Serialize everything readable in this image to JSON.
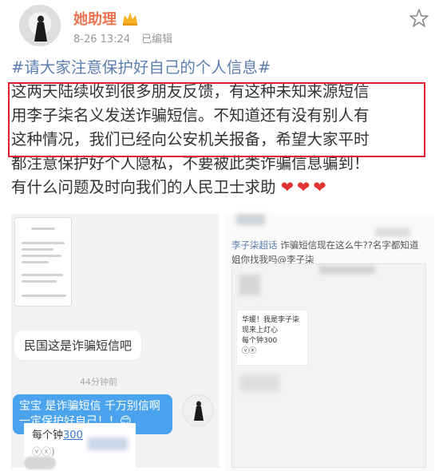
{
  "header": {
    "username": "她助理",
    "date": "8-26 13:24",
    "edited": "已编辑"
  },
  "post": {
    "hashtag": "#请大家注意保护好自己的个人信息#",
    "line1": "这两天陆续收到很多朋友反馈，有这种未知来源短信",
    "line2": "用李子柒名义发送诈骗短信。不知道还有没有别人有",
    "line3": "这种情况，我们已经向公安机关报备，希望大家平时",
    "line4": "都注意保护好个人隐私，不要被此类诈骗信息骗到！",
    "line5": "有什么问题及时向我们的人民卫士求助",
    "hearts": "❤❤❤"
  },
  "left_screenshot": {
    "bubble_left": "民国这是诈骗短信吧",
    "time": "44分钟前",
    "bubble_right": "宝宝  是诈骗短信  千万别信啊  一定保护好自己！！😊",
    "strip_row1_prefix": "每个钟",
    "strip_row1_link": "300",
    "strip_row2": "ⓥⓧ)"
  },
  "right_screenshot": {
    "line1_tag": "李子柒超话",
    "line1_text": "诈骗短信现在这么牛??名字都知道",
    "line2_text": "姐你找我吗@李子柒",
    "card_line1": "华媛！我是李子柒",
    "card_line2": "现来上灯心",
    "card_line3": "每个钟300",
    "card_line4": "ⓥⓧ"
  },
  "colors": {
    "username": "#eb7350",
    "hashtag": "#5d7eb0",
    "highlight_box": "#e21d2b",
    "heart": "#e33434",
    "bubble_blue": "#4aa3ec"
  }
}
